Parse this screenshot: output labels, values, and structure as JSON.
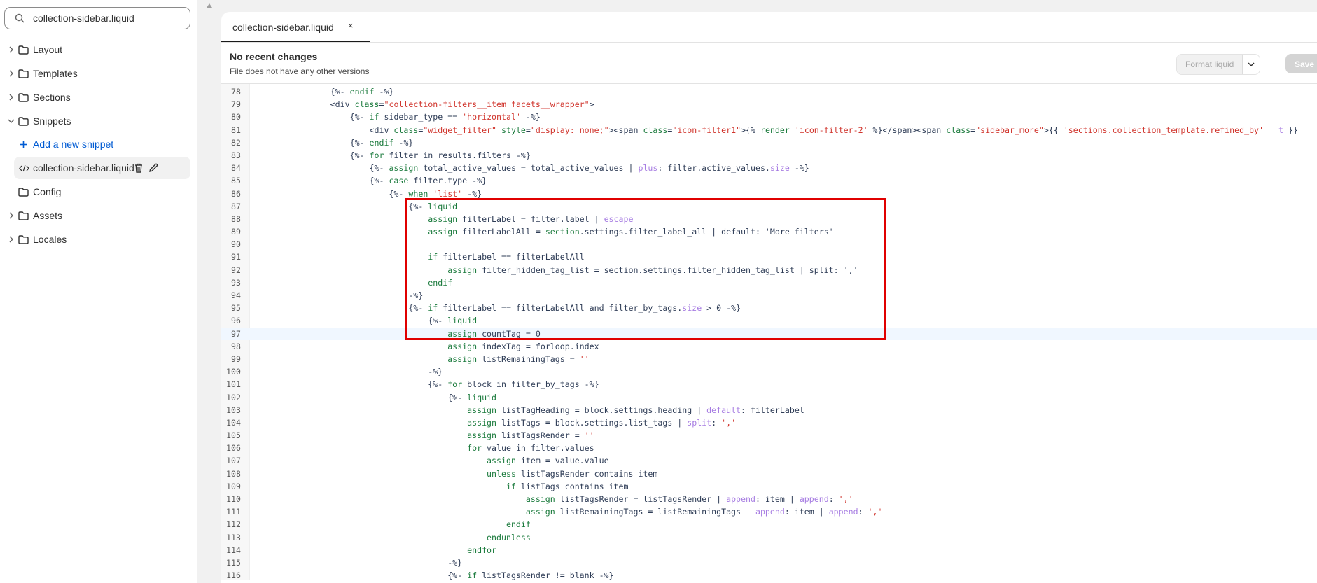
{
  "sidebar": {
    "search": {
      "value": "collection-sidebar.liquid",
      "icon": "search-icon"
    },
    "items": [
      {
        "label": "Layout",
        "type": "folder",
        "expanded": false
      },
      {
        "label": "Templates",
        "type": "folder",
        "expanded": false
      },
      {
        "label": "Sections",
        "type": "folder",
        "expanded": false
      },
      {
        "label": "Snippets",
        "type": "folder",
        "expanded": true
      },
      {
        "label": "Add a new snippet",
        "type": "add"
      },
      {
        "label": "collection-sidebar.liquid",
        "type": "file",
        "selected": true
      },
      {
        "label": "Config",
        "type": "folder-leaf"
      },
      {
        "label": "Assets",
        "type": "folder",
        "expanded": false
      },
      {
        "label": "Locales",
        "type": "folder",
        "expanded": false
      }
    ]
  },
  "editor": {
    "tab": {
      "label": "collection-sidebar.liquid",
      "close": "×"
    },
    "header": {
      "title": "No recent changes",
      "subtitle": "File does not have any other versions"
    },
    "format_button": "Format liquid",
    "save_button": "Save",
    "active_line": 97,
    "highlight_box": {
      "from_line": 87,
      "to_line": 95,
      "color": "#e00000"
    },
    "lines": [
      {
        "n": 78,
        "segs": [
          [
            "p",
            "                {%- "
          ],
          [
            "k",
            "endif"
          ],
          [
            "p",
            " -%}"
          ]
        ]
      },
      {
        "n": 79,
        "segs": [
          [
            "p",
            "                <div "
          ],
          [
            "k",
            "class"
          ],
          [
            "p",
            "="
          ],
          [
            "s",
            "\"collection-filters__item facets__wrapper\""
          ],
          [
            "p",
            ">"
          ]
        ]
      },
      {
        "n": 80,
        "segs": [
          [
            "p",
            "                    {%- "
          ],
          [
            "k",
            "if"
          ],
          [
            "p",
            " sidebar_type == "
          ],
          [
            "s",
            "'horizontal'"
          ],
          [
            "p",
            " -%}"
          ]
        ]
      },
      {
        "n": 81,
        "segs": [
          [
            "p",
            "                        <div "
          ],
          [
            "k",
            "class"
          ],
          [
            "p",
            "="
          ],
          [
            "s",
            "\"widget_filter\""
          ],
          [
            "p",
            " "
          ],
          [
            "k",
            "style"
          ],
          [
            "p",
            "="
          ],
          [
            "s",
            "\"display: none;\""
          ],
          [
            "p",
            "><span "
          ],
          [
            "k",
            "class"
          ],
          [
            "p",
            "="
          ],
          [
            "s",
            "\"icon-filter1\""
          ],
          [
            "p",
            ">{% "
          ],
          [
            "k",
            "render"
          ],
          [
            "p",
            " "
          ],
          [
            "s",
            "'icon-filter-2'"
          ],
          [
            "p",
            " %}</span><span "
          ],
          [
            "k",
            "class"
          ],
          [
            "p",
            "="
          ],
          [
            "s",
            "\"sidebar_more\""
          ],
          [
            "p",
            ">{{ "
          ],
          [
            "s",
            "'sections.collection_template.refined_by'"
          ],
          [
            "p",
            " | "
          ],
          [
            "f",
            "t"
          ],
          [
            "p",
            " }}"
          ]
        ]
      },
      {
        "n": 82,
        "segs": [
          [
            "p",
            "                    {%- "
          ],
          [
            "k",
            "endif"
          ],
          [
            "p",
            " -%}"
          ]
        ]
      },
      {
        "n": 83,
        "segs": [
          [
            "p",
            "                    {%- "
          ],
          [
            "k",
            "for"
          ],
          [
            "p",
            " filter in results.filters -%}"
          ]
        ]
      },
      {
        "n": 84,
        "segs": [
          [
            "p",
            "                        {%- "
          ],
          [
            "k",
            "assign"
          ],
          [
            "p",
            " total_active_values = total_active_values | "
          ],
          [
            "f",
            "plus"
          ],
          [
            "p",
            ": filter.active_values."
          ],
          [
            "f",
            "size"
          ],
          [
            "p",
            " -%}"
          ]
        ]
      },
      {
        "n": 85,
        "segs": [
          [
            "p",
            "                        {%- "
          ],
          [
            "k",
            "case"
          ],
          [
            "p",
            " filter.type -%}"
          ]
        ]
      },
      {
        "n": 86,
        "segs": [
          [
            "p",
            "                            {%- "
          ],
          [
            "k",
            "when"
          ],
          [
            "p",
            " "
          ],
          [
            "s",
            "'list'"
          ],
          [
            "p",
            " -%}"
          ]
        ]
      },
      {
        "n": 87,
        "segs": [
          [
            "p",
            "                                {%- "
          ],
          [
            "k",
            "liquid"
          ]
        ]
      },
      {
        "n": 88,
        "segs": [
          [
            "p",
            "                                    "
          ],
          [
            "k",
            "assign"
          ],
          [
            "p",
            " filterLabel = filter.label | "
          ],
          [
            "f",
            "escape"
          ]
        ]
      },
      {
        "n": 89,
        "segs": [
          [
            "p",
            "                                    "
          ],
          [
            "k",
            "assign"
          ],
          [
            "p",
            " filterLabelAll = "
          ],
          [
            "k",
            "section"
          ],
          [
            "p",
            ".settings.filter_label_all | default: 'More filters'"
          ]
        ]
      },
      {
        "n": 90,
        "segs": []
      },
      {
        "n": 91,
        "segs": [
          [
            "p",
            "                                    "
          ],
          [
            "k",
            "if"
          ],
          [
            "p",
            " filterLabel == filterLabelAll"
          ]
        ]
      },
      {
        "n": 92,
        "segs": [
          [
            "p",
            "                                        "
          ],
          [
            "k",
            "assign"
          ],
          [
            "p",
            " filter_hidden_tag_list = section.settings.filter_hidden_tag_list | split: ','"
          ]
        ]
      },
      {
        "n": 93,
        "segs": [
          [
            "p",
            "                                    "
          ],
          [
            "k",
            "endif"
          ]
        ]
      },
      {
        "n": 94,
        "segs": [
          [
            "p",
            "                                -%}"
          ]
        ]
      },
      {
        "n": 95,
        "segs": [
          [
            "p",
            "                                {%- "
          ],
          [
            "k",
            "if"
          ],
          [
            "p",
            " filterLabel == filterLabelAll and filter_by_tags."
          ],
          [
            "f",
            "size"
          ],
          [
            "p",
            " > 0 -%}"
          ]
        ]
      },
      {
        "n": 96,
        "segs": [
          [
            "p",
            "                                    {%- "
          ],
          [
            "k",
            "liquid"
          ]
        ]
      },
      {
        "n": 97,
        "segs": [
          [
            "p",
            "                                        "
          ],
          [
            "k",
            "assign"
          ],
          [
            "p",
            " countTag = 0"
          ]
        ]
      },
      {
        "n": 98,
        "segs": [
          [
            "p",
            "                                        "
          ],
          [
            "k",
            "assign"
          ],
          [
            "p",
            " indexTag = forloop.index"
          ]
        ]
      },
      {
        "n": 99,
        "segs": [
          [
            "p",
            "                                        "
          ],
          [
            "k",
            "assign"
          ],
          [
            "p",
            " listRemainingTags = "
          ],
          [
            "s",
            "''"
          ]
        ]
      },
      {
        "n": 100,
        "segs": [
          [
            "p",
            "                                    -%}"
          ]
        ]
      },
      {
        "n": 101,
        "segs": [
          [
            "p",
            "                                    {%- "
          ],
          [
            "k",
            "for"
          ],
          [
            "p",
            " block in filter_by_tags -%}"
          ]
        ]
      },
      {
        "n": 102,
        "segs": [
          [
            "p",
            "                                        {%- "
          ],
          [
            "k",
            "liquid"
          ]
        ]
      },
      {
        "n": 103,
        "segs": [
          [
            "p",
            "                                            "
          ],
          [
            "k",
            "assign"
          ],
          [
            "p",
            " listTagHeading = block.settings.heading | "
          ],
          [
            "f",
            "default"
          ],
          [
            "p",
            ": filterLabel"
          ]
        ]
      },
      {
        "n": 104,
        "segs": [
          [
            "p",
            "                                            "
          ],
          [
            "k",
            "assign"
          ],
          [
            "p",
            " listTags = block.settings.list_tags | "
          ],
          [
            "f",
            "split"
          ],
          [
            "p",
            ": "
          ],
          [
            "s",
            "','"
          ]
        ]
      },
      {
        "n": 105,
        "segs": [
          [
            "p",
            "                                            "
          ],
          [
            "k",
            "assign"
          ],
          [
            "p",
            " listTagsRender = "
          ],
          [
            "s",
            "''"
          ]
        ]
      },
      {
        "n": 106,
        "segs": [
          [
            "p",
            "                                            "
          ],
          [
            "k",
            "for"
          ],
          [
            "p",
            " value in filter.values"
          ]
        ]
      },
      {
        "n": 107,
        "segs": [
          [
            "p",
            "                                                "
          ],
          [
            "k",
            "assign"
          ],
          [
            "p",
            " item = value.value"
          ]
        ]
      },
      {
        "n": 108,
        "segs": [
          [
            "p",
            "                                                "
          ],
          [
            "k",
            "unless"
          ],
          [
            "p",
            " listTagsRender contains item"
          ]
        ]
      },
      {
        "n": 109,
        "segs": [
          [
            "p",
            "                                                    "
          ],
          [
            "k",
            "if"
          ],
          [
            "p",
            " listTags contains item"
          ]
        ]
      },
      {
        "n": 110,
        "segs": [
          [
            "p",
            "                                                        "
          ],
          [
            "k",
            "assign"
          ],
          [
            "p",
            " listTagsRender = listTagsRender | "
          ],
          [
            "f",
            "append"
          ],
          [
            "p",
            ": item | "
          ],
          [
            "f",
            "append"
          ],
          [
            "p",
            ": "
          ],
          [
            "s",
            "','"
          ]
        ]
      },
      {
        "n": 111,
        "segs": [
          [
            "p",
            "                                                        "
          ],
          [
            "k",
            "assign"
          ],
          [
            "p",
            " listRemainingTags = listRemainingTags | "
          ],
          [
            "f",
            "append"
          ],
          [
            "p",
            ": item | "
          ],
          [
            "f",
            "append"
          ],
          [
            "p",
            ": "
          ],
          [
            "s",
            "','"
          ]
        ]
      },
      {
        "n": 112,
        "segs": [
          [
            "p",
            "                                                    "
          ],
          [
            "k",
            "endif"
          ]
        ]
      },
      {
        "n": 113,
        "segs": [
          [
            "p",
            "                                                "
          ],
          [
            "k",
            "endunless"
          ]
        ]
      },
      {
        "n": 114,
        "segs": [
          [
            "p",
            "                                            "
          ],
          [
            "k",
            "endfor"
          ]
        ]
      },
      {
        "n": 115,
        "segs": [
          [
            "p",
            "                                        -%}"
          ]
        ]
      },
      {
        "n": 116,
        "segs": [
          [
            "p",
            "                                        {%- "
          ],
          [
            "k",
            "if"
          ],
          [
            "p",
            " listTagsRender != blank -%}"
          ]
        ]
      }
    ]
  }
}
